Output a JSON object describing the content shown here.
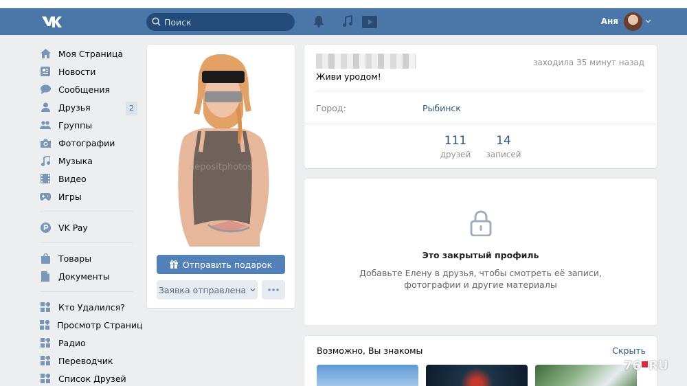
{
  "header": {
    "search_placeholder": "Поиск",
    "user_name": "Аня"
  },
  "sidebar": {
    "items": [
      {
        "label": "Моя Страница",
        "icon": "home-icon"
      },
      {
        "label": "Новости",
        "icon": "news-icon"
      },
      {
        "label": "Сообщения",
        "icon": "messages-icon"
      },
      {
        "label": "Друзья",
        "icon": "friends-icon",
        "badge": "2"
      },
      {
        "label": "Группы",
        "icon": "groups-icon"
      },
      {
        "label": "Фотографии",
        "icon": "camera-icon"
      },
      {
        "label": "Музыка",
        "icon": "music-icon"
      },
      {
        "label": "Видео",
        "icon": "video-icon"
      },
      {
        "label": "Игры",
        "icon": "gamepad-icon"
      },
      {
        "label": "VK Pay",
        "icon": "vkpay-icon"
      },
      {
        "label": "Товары",
        "icon": "bag-icon"
      },
      {
        "label": "Документы",
        "icon": "document-icon"
      },
      {
        "label": "Кто Удалился?",
        "icon": "app-icon"
      },
      {
        "label": "Просмотр Страниц",
        "icon": "app-icon"
      },
      {
        "label": "Радио",
        "icon": "app-icon"
      },
      {
        "label": "Переводчик",
        "icon": "app-icon"
      },
      {
        "label": "Список Друзей",
        "icon": "app-icon"
      }
    ]
  },
  "profile": {
    "gift_button": "Отправить подарок",
    "request_button": "Заявка отправлена",
    "last_seen": "заходила 35 минут назад",
    "status": "Живи уродом!",
    "city_label": "Город:",
    "city_value": "Рыбинск",
    "counters": [
      {
        "num": "111",
        "label": "друзей"
      },
      {
        "num": "14",
        "label": "записей"
      }
    ]
  },
  "private": {
    "title": "Это закрытый профиль",
    "line1": "Добавьте Елену в друзья, чтобы смотреть её записи,",
    "line2": "фотографии и другие материалы"
  },
  "suggestions": {
    "title": "Возможно, Вы знакомы",
    "hide": "Скрыть"
  },
  "watermark": {
    "left": "76",
    "right": "RU"
  },
  "colors": {
    "header": "#4a76a8",
    "link": "#2a5885",
    "button_primary": "#5181b8"
  }
}
